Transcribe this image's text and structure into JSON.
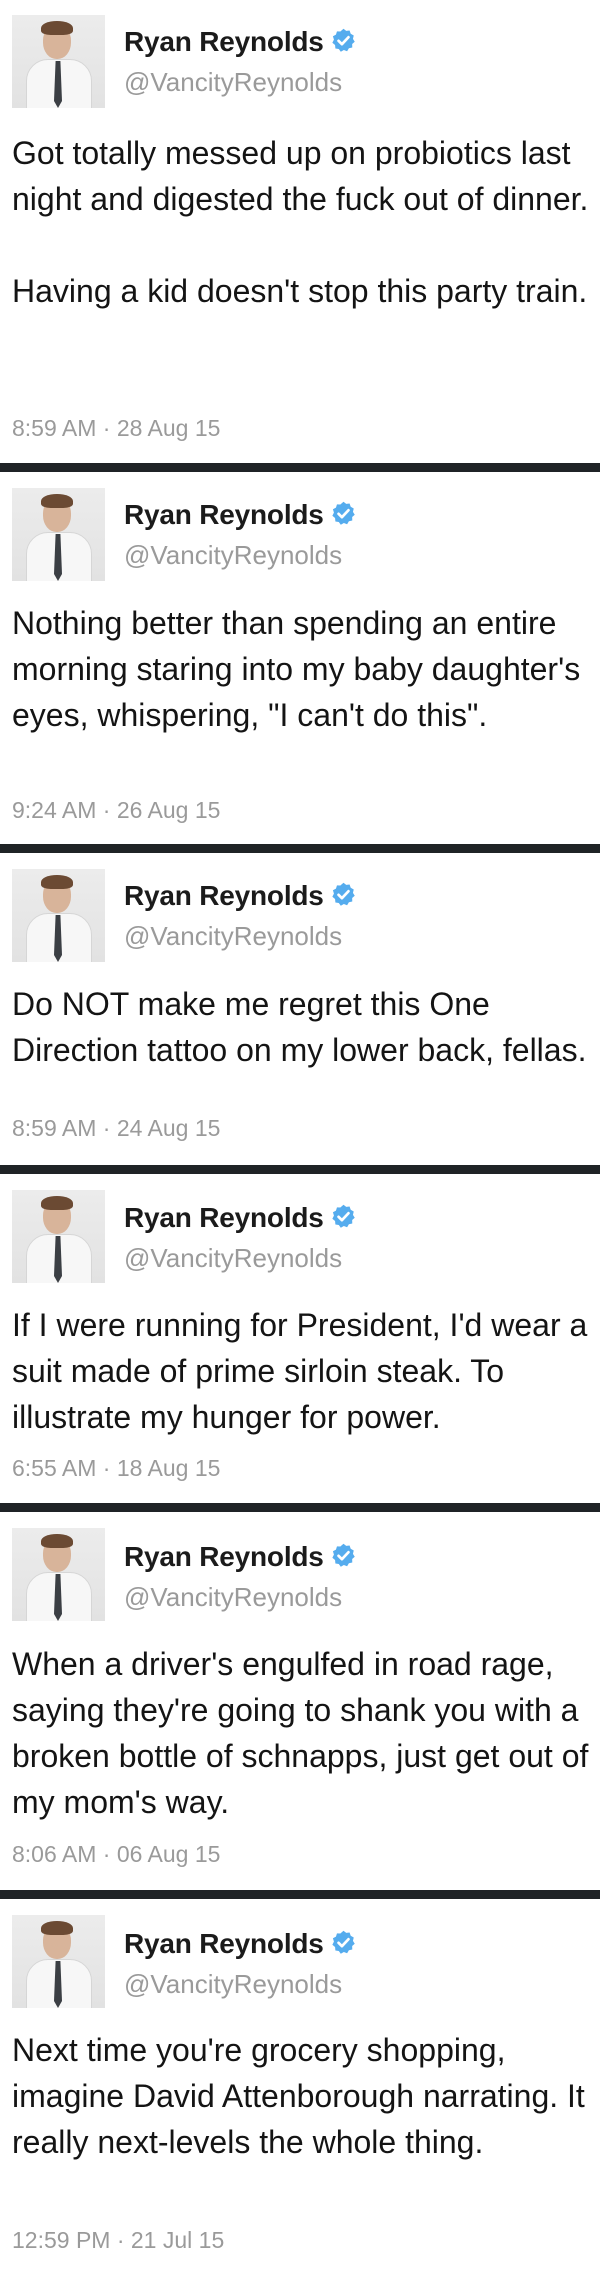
{
  "tweets": [
    {
      "author": "Ryan Reynolds",
      "handle": "@VancityReynolds",
      "text": "Got totally messed up on probiotics last night and digested the fuck out of dinner.\n\nHaving a kid doesn't stop this party train.",
      "timestamp": "8:59 AM · 28 Aug 15"
    },
    {
      "author": "Ryan Reynolds",
      "handle": "@VancityReynolds",
      "text": "Nothing better than spending an entire morning staring into my baby daughter's eyes, whispering, \"I can't do this\".",
      "timestamp": "9:24 AM · 26 Aug 15"
    },
    {
      "author": "Ryan Reynolds",
      "handle": "@VancityReynolds",
      "text": "Do NOT make me regret this One Direction tattoo on my lower back, fellas.",
      "timestamp": "8:59 AM · 24 Aug 15"
    },
    {
      "author": "Ryan Reynolds",
      "handle": "@VancityReynolds",
      "text": "If I were running for President, I'd wear a suit made of prime sirloin steak. To illustrate my hunger for power.",
      "timestamp": "6:55 AM · 18 Aug 15"
    },
    {
      "author": "Ryan Reynolds",
      "handle": "@VancityReynolds",
      "text": "When a driver's engulfed in road rage, saying they're going to shank you with a broken bottle of schnapps, just get out of my mom's way.",
      "timestamp": "8:06 AM · 06 Aug 15"
    },
    {
      "author": "Ryan Reynolds",
      "handle": "@VancityReynolds",
      "text": "Next time you're grocery shopping, imagine David Attenborough narrating. It really next-levels the whole thing.",
      "timestamp": "12:59 PM · 21 Jul 15"
    }
  ],
  "icons": {
    "verified": "verified-badge-icon",
    "avatar": "avatar"
  },
  "colors": {
    "verified": "#55acee",
    "divider": "#1f2326",
    "muted": "#9a9a9a"
  }
}
